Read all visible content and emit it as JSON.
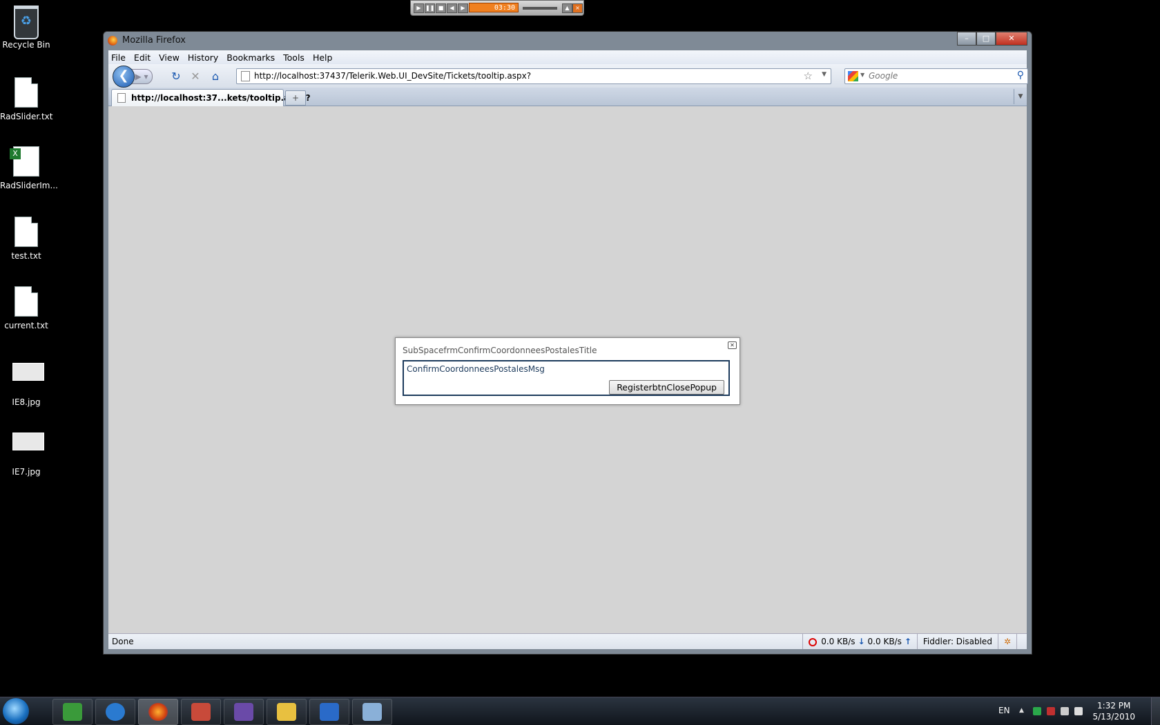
{
  "desktop": {
    "icons": [
      {
        "label": "Recycle Bin",
        "icon": "recycle-bin-icon"
      },
      {
        "label": "RadSlider.txt",
        "icon": "text-file-icon"
      },
      {
        "label": "RadSliderIm...",
        "icon": "excel-file-icon"
      },
      {
        "label": "test.txt",
        "icon": "text-file-icon"
      },
      {
        "label": "current.txt",
        "icon": "text-file-icon"
      },
      {
        "label": "IE8.jpg",
        "icon": "image-file-icon"
      },
      {
        "label": "IE7.jpg",
        "icon": "image-file-icon"
      }
    ]
  },
  "media_player": {
    "time": "03:30"
  },
  "window": {
    "title": "Mozilla Firefox",
    "menu": [
      "File",
      "Edit",
      "View",
      "History",
      "Bookmarks",
      "Tools",
      "Help"
    ],
    "url": "http://localhost:37437/Telerik.Web.UI_DevSite/Tickets/tooltip.aspx?",
    "search_placeholder": "Google",
    "tab_title": "http://localhost:37...kets/tooltip.aspx?",
    "newtab_glyph": "+",
    "status": {
      "text": "Done",
      "down_speed": "0.0 KB/s",
      "up_speed": "0.0 KB/s",
      "fiddler": "Fiddler: Disabled"
    }
  },
  "dialog": {
    "title": "SubSpacefrmConfirmCoordonneesPostalesTitle",
    "message": "ConfirmCoordonneesPostalesMsg",
    "button_label": "RegisterbtnClosePopup"
  },
  "taskbar": {
    "language": "EN",
    "time": "1:32 PM",
    "date": "5/13/2010"
  },
  "colors": {
    "desktop": "#000000",
    "content_bg": "#d4d4d4",
    "dialog_border": "#1c3a5c",
    "accent_blue": "#1a58b0"
  }
}
